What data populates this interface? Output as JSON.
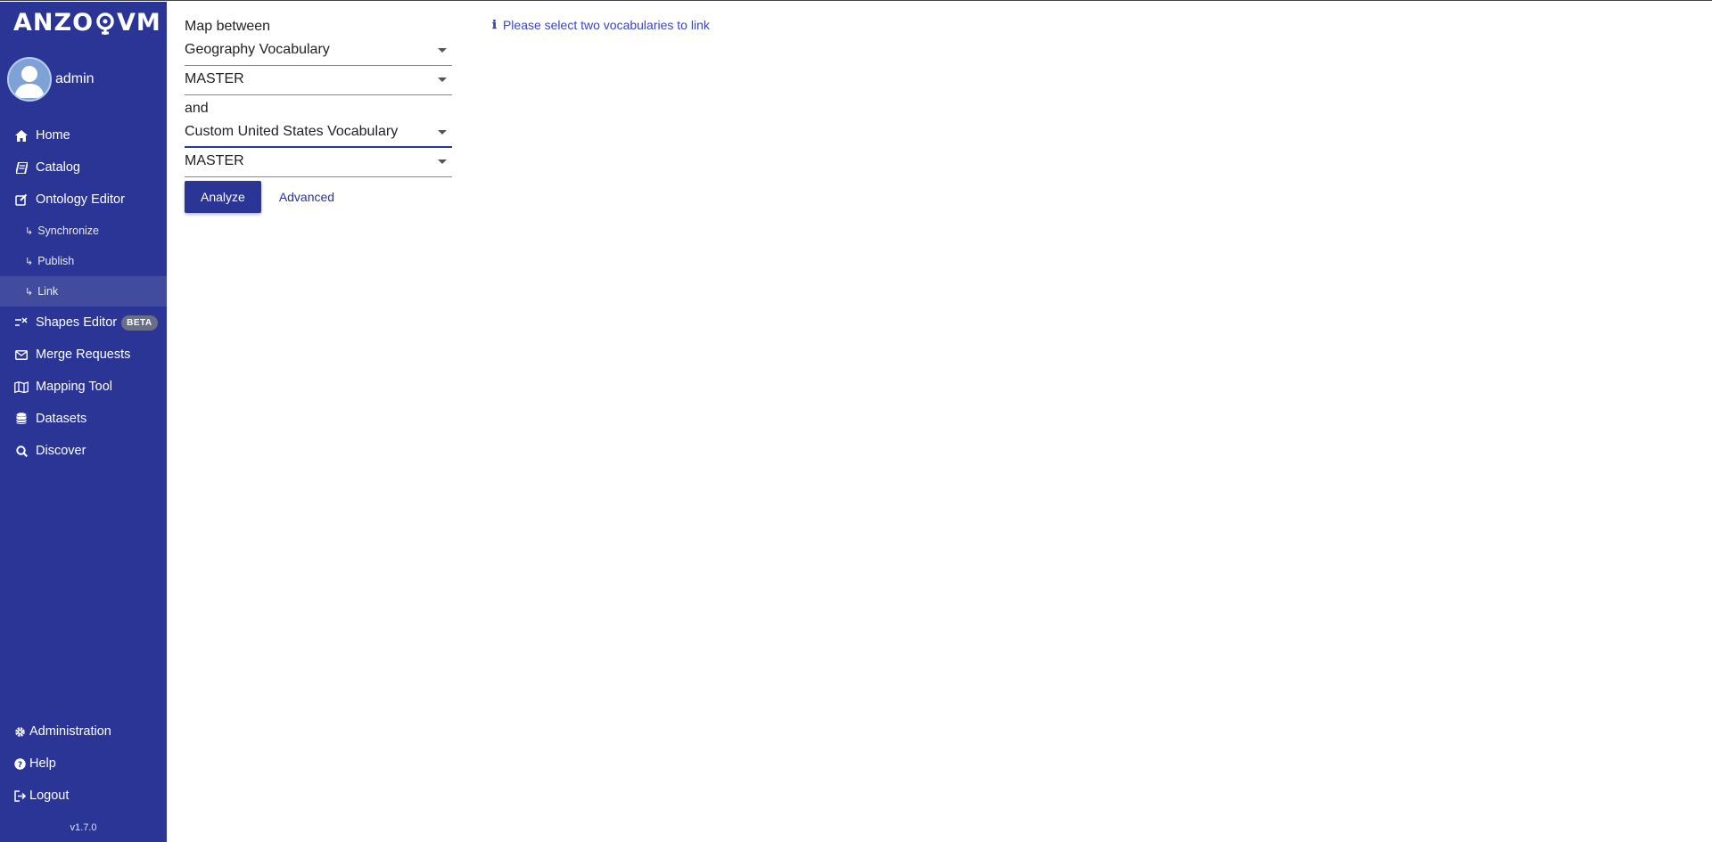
{
  "app": {
    "logo_text_left": "ANZO",
    "logo_text_right": "VM",
    "version": "v1.7.0"
  },
  "user": {
    "name": "admin"
  },
  "sidebar": {
    "items": [
      {
        "label": "Home",
        "icon": "home-icon"
      },
      {
        "label": "Catalog",
        "icon": "book-icon"
      },
      {
        "label": "Ontology Editor",
        "icon": "edit-icon"
      }
    ],
    "sub_items": [
      {
        "label": "Synchronize",
        "arrow": "↳"
      },
      {
        "label": "Publish",
        "arrow": "↳"
      },
      {
        "label": "Link",
        "arrow": "↳",
        "active": true
      }
    ],
    "items2": [
      {
        "label": "Shapes Editor",
        "icon": "shapes-icon",
        "badge": "BETA"
      },
      {
        "label": "Merge Requests",
        "icon": "envelope-icon"
      },
      {
        "label": "Mapping Tool",
        "icon": "map-icon"
      },
      {
        "label": "Datasets",
        "icon": "database-icon"
      },
      {
        "label": "Discover",
        "icon": "search-icon"
      }
    ],
    "bottom_items": [
      {
        "label": "Administration",
        "icon": "gear-icon"
      },
      {
        "label": "Help",
        "icon": "question-icon"
      },
      {
        "label": "Logout",
        "icon": "logout-icon"
      }
    ]
  },
  "form": {
    "map_between_label": "Map between",
    "vocab1": "Geography Vocabulary",
    "branch1": "MASTER",
    "and_label": "and",
    "vocab2": "Custom United States Vocabulary",
    "branch2": "MASTER",
    "analyze_label": "Analyze",
    "advanced_label": "Advanced"
  },
  "message": {
    "icon": "ℹ",
    "text": "Please select two vocabularies to link"
  },
  "colors": {
    "sidebar": "#2b3595",
    "active_item": "#424c9f",
    "accent": "#2b3595",
    "info_text": "#3a45c4"
  }
}
